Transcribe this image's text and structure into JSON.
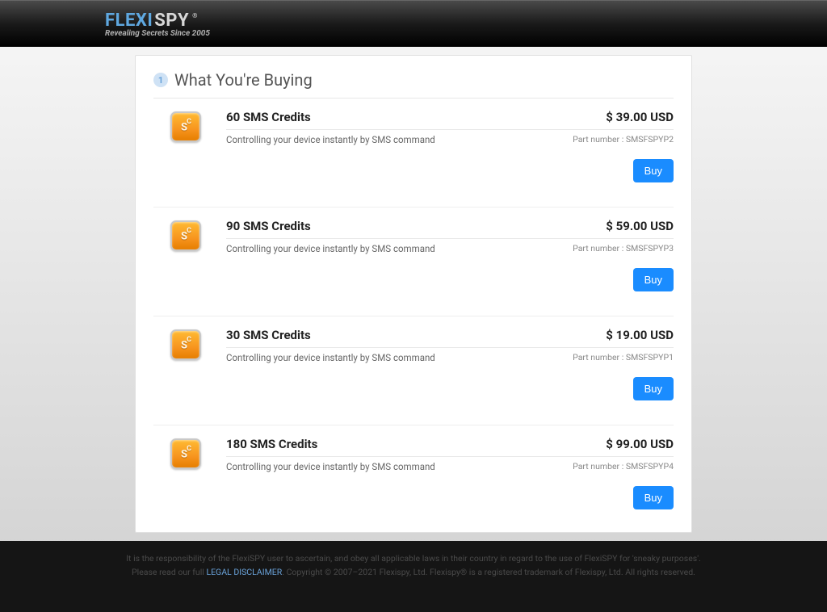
{
  "header": {
    "logo_flexi": "FLEXI",
    "logo_spy": "SPY",
    "logo_reg": "®",
    "tagline": "Revealing Secrets Since 2005"
  },
  "section": {
    "step": "1",
    "title": "What You're Buying"
  },
  "part_label": "Part number : ",
  "buy_label": "Buy",
  "icon_label": "SC",
  "products": [
    {
      "title": "60 SMS Credits",
      "desc": "Controlling your device instantly by SMS command",
      "price": "$ 39.00 USD",
      "part": "SMSFSPYP2"
    },
    {
      "title": "90 SMS Credits",
      "desc": "Controlling your device instantly by SMS command",
      "price": "$ 59.00 USD",
      "part": "SMSFSPYP3"
    },
    {
      "title": "30 SMS Credits",
      "desc": "Controlling your device instantly by SMS command",
      "price": "$ 19.00 USD",
      "part": "SMSFSPYP1"
    },
    {
      "title": "180 SMS Credits",
      "desc": "Controlling your device instantly by SMS command",
      "price": "$ 99.00 USD",
      "part": "SMSFSPYP4"
    }
  ],
  "footer": {
    "line1": "It is the responsibility of the FlexiSPY user to ascertain, and obey all applicable laws in their country in regard to the use of FlexiSPY for 'sneaky purposes'.",
    "line2a": "Please read our full ",
    "disclaimer_link": "LEGAL DISCLAIMER",
    "line2b": ". Copyright © 2007–2021 Flexispy, Ltd. Flexispy® is a registered trademark of Flexispy, Ltd. All rights reserved."
  }
}
